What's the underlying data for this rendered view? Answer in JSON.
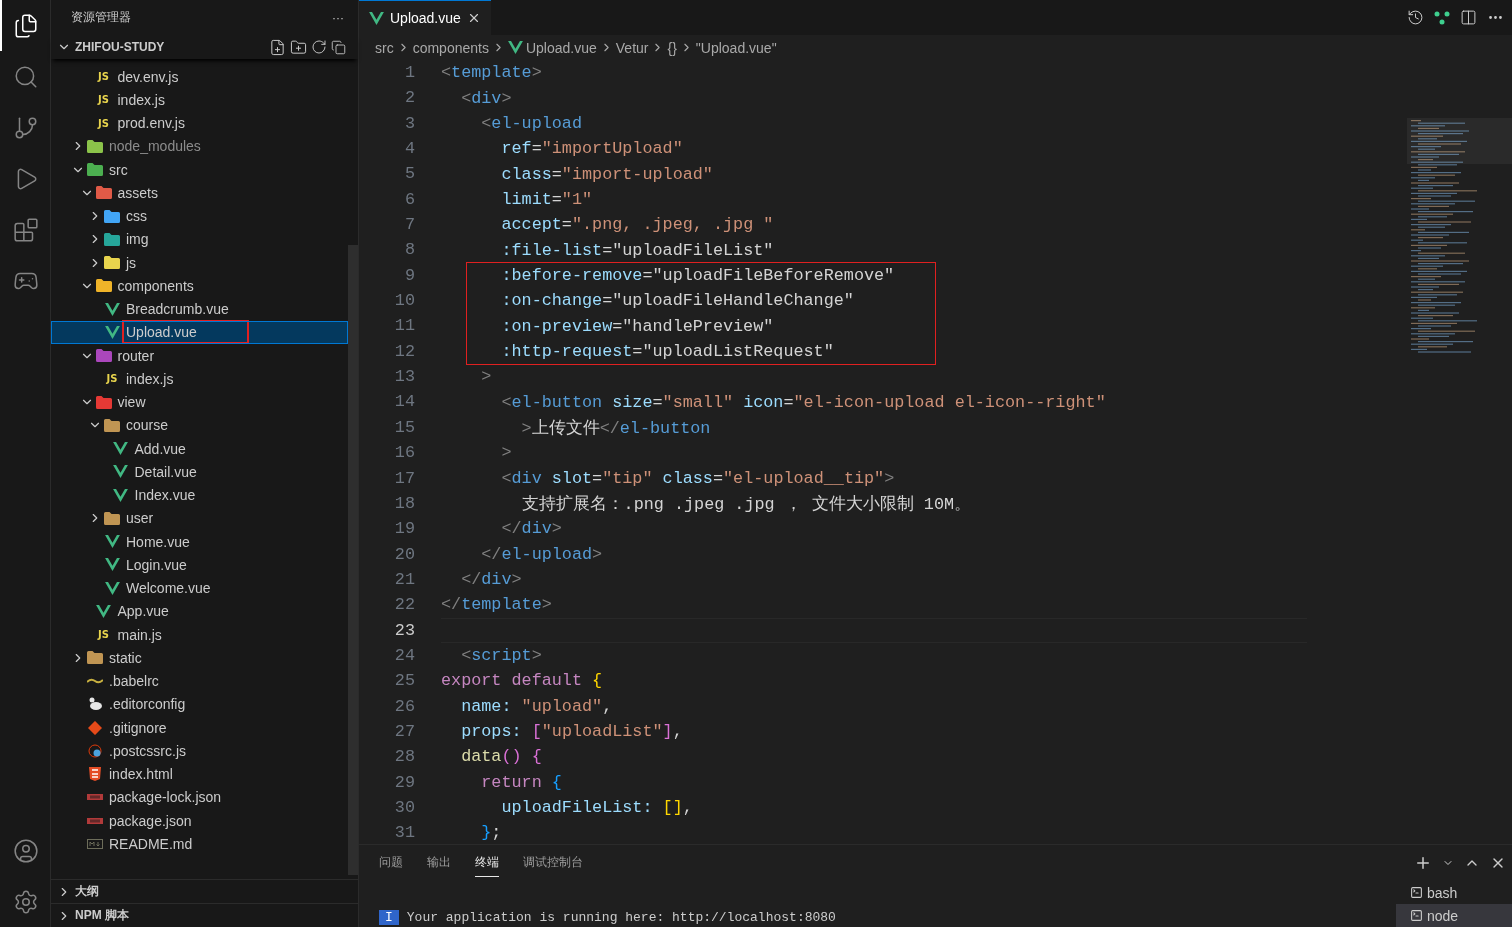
{
  "activity_bar": {
    "items": [
      {
        "kind": "explorer",
        "selected": true
      },
      {
        "kind": "search",
        "selected": false
      },
      {
        "kind": "source-control",
        "selected": false
      },
      {
        "kind": "run",
        "selected": false
      },
      {
        "kind": "extensions",
        "selected": false
      },
      {
        "kind": "remote",
        "selected": false
      }
    ],
    "bottom": [
      {
        "kind": "account"
      },
      {
        "kind": "settings"
      }
    ]
  },
  "sidebar": {
    "title": "资源管理器",
    "more": "···",
    "project": "ZHIFOU-STUDY",
    "tree": [
      {
        "children": [
          {
            "kind": "script",
            "name": "dev.env.js",
            "badge": "JS",
            "selected": false,
            "boxed": false
          },
          {
            "kind": "script",
            "name": "index.js",
            "badge": "JS",
            "selected": false,
            "boxed": false
          },
          {
            "kind": "script",
            "name": "prod.env.js",
            "badge": "JS",
            "selected": false,
            "boxed": false
          }
        ]
      },
      {
        "kind": "folder",
        "name": "node_modules",
        "color": "#8bc34a",
        "expanded": false,
        "dim": true
      },
      {
        "kind": "folder",
        "name": "src",
        "color": "#4caf50",
        "expanded": true,
        "children": [
          {
            "kind": "folder",
            "name": "assets",
            "color": "#e05a47",
            "expanded": true,
            "children": [
              {
                "kind": "folder",
                "name": "css",
                "color": "#42a5f5",
                "expanded": false
              },
              {
                "kind": "folder",
                "name": "img",
                "color": "#26a69a",
                "expanded": false
              },
              {
                "kind": "folder",
                "name": "js",
                "color": "#e8d44d",
                "expanded": false
              }
            ]
          },
          {
            "kind": "folder",
            "name": "components",
            "color": "#f0b429",
            "expanded": true,
            "children": [
              {
                "kind": "vue",
                "name": "Breadcrumb.vue",
                "selected": false,
                "boxed": false
              },
              {
                "kind": "vue",
                "name": "Upload.vue",
                "selected": true,
                "boxed": true
              }
            ]
          },
          {
            "kind": "folder",
            "name": "router",
            "color": "#ab47bc",
            "expanded": true,
            "children": [
              {
                "kind": "script",
                "name": "index.js",
                "badge": "JS",
                "selected": false,
                "boxed": false
              }
            ]
          },
          {
            "kind": "folder",
            "name": "view",
            "color": "#e53935",
            "expanded": true,
            "children": [
              {
                "kind": "folder",
                "name": "course",
                "color": "#c09553",
                "expanded": true,
                "children": [
                  {
                    "kind": "vue",
                    "name": "Add.vue",
                    "selected": false,
                    "boxed": false
                  },
                  {
                    "kind": "vue",
                    "name": "Detail.vue",
                    "selected": false,
                    "boxed": false
                  },
                  {
                    "kind": "vue",
                    "name": "Index.vue",
                    "selected": false,
                    "boxed": false
                  }
                ]
              },
              {
                "kind": "folder",
                "name": "user",
                "color": "#c09553",
                "expanded": false
              },
              {
                "kind": "vue",
                "name": "Home.vue",
                "selected": false,
                "boxed": false
              },
              {
                "kind": "vue",
                "name": "Login.vue",
                "selected": false,
                "boxed": false
              },
              {
                "kind": "vue",
                "name": "Welcome.vue",
                "selected": false,
                "boxed": false
              }
            ]
          },
          {
            "kind": "vue",
            "name": "App.vue",
            "selected": false,
            "boxed": false
          },
          {
            "kind": "script",
            "name": "main.js",
            "badge": "JS",
            "selected": false,
            "boxed": false
          }
        ]
      },
      {
        "kind": "folder",
        "name": "static",
        "color": "#c09553",
        "expanded": false
      },
      {
        "kind": "babel",
        "name": ".babelrc",
        "selected": false,
        "boxed": false
      },
      {
        "kind": "editorconfig",
        "name": ".editorconfig",
        "selected": false,
        "boxed": false
      },
      {
        "kind": "git",
        "name": ".gitignore",
        "selected": false,
        "boxed": false
      },
      {
        "kind": "postcss",
        "name": ".postcssrc.js",
        "selected": false,
        "boxed": false
      },
      {
        "kind": "html",
        "name": "index.html",
        "selected": false,
        "boxed": false
      },
      {
        "kind": "npm",
        "name": "package-lock.json",
        "selected": false,
        "boxed": false
      },
      {
        "kind": "npm",
        "name": "package.json",
        "selected": false,
        "boxed": false
      },
      {
        "kind": "markdown",
        "name": "README.md",
        "selected": false,
        "boxed": false
      }
    ],
    "sections": [
      {
        "title": "大纲",
        "expanded": false
      },
      {
        "title": "NPM 脚本",
        "expanded": false
      }
    ]
  },
  "editor": {
    "tabs": [
      {
        "label": "Upload.vue",
        "selected": true
      }
    ],
    "breadcrumbs": [
      {
        "label": "src"
      },
      {
        "label": "components"
      },
      {
        "label": "Upload.vue",
        "kind": "vue"
      },
      {
        "label": "Vetur"
      },
      {
        "label": "{}"
      },
      {
        "label": "\"Upload.vue\""
      }
    ],
    "lines": [
      {
        "number": "1",
        "current": false,
        "boxed": false,
        "tokens": [
          {
            "kind": "br",
            "text": "<"
          },
          {
            "kind": "tag",
            "text": "template"
          },
          {
            "kind": "br",
            "text": ">"
          }
        ]
      },
      {
        "number": "2",
        "current": false,
        "boxed": false,
        "tokens": [
          {
            "kind": "br",
            "text": "  <"
          },
          {
            "kind": "tag",
            "text": "div"
          },
          {
            "kind": "br",
            "text": ">"
          }
        ]
      },
      {
        "number": "3",
        "current": false,
        "boxed": false,
        "tokens": [
          {
            "kind": "br",
            "text": "    <"
          },
          {
            "kind": "tag",
            "text": "el-upload"
          }
        ]
      },
      {
        "number": "4",
        "current": false,
        "boxed": false,
        "tokens": [
          {
            "kind": "attr",
            "text": "      ref"
          },
          {
            "kind": "plain",
            "text": "="
          },
          {
            "kind": "str",
            "text": "\"importUpload\""
          }
        ]
      },
      {
        "number": "5",
        "current": false,
        "boxed": false,
        "tokens": [
          {
            "kind": "attr",
            "text": "      class"
          },
          {
            "kind": "plain",
            "text": "="
          },
          {
            "kind": "str",
            "text": "\"import-upload\""
          }
        ]
      },
      {
        "number": "6",
        "current": false,
        "boxed": false,
        "tokens": [
          {
            "kind": "attr",
            "text": "      limit"
          },
          {
            "kind": "plain",
            "text": "="
          },
          {
            "kind": "str",
            "text": "\"1\""
          }
        ]
      },
      {
        "number": "7",
        "current": false,
        "boxed": false,
        "tokens": [
          {
            "kind": "attr",
            "text": "      accept"
          },
          {
            "kind": "plain",
            "text": "="
          },
          {
            "kind": "str",
            "text": "\".png, .jpeg, .jpg \""
          }
        ]
      },
      {
        "number": "8",
        "current": false,
        "boxed": false,
        "tokens": [
          {
            "kind": "attr",
            "text": "      :file-list"
          },
          {
            "kind": "plain",
            "text": "=\"uploadFileList\""
          }
        ]
      },
      {
        "number": "9",
        "current": false,
        "boxed": true,
        "tokens": [
          {
            "kind": "attr",
            "text": "      :before-remove"
          },
          {
            "kind": "plain",
            "text": "=\"uploadFileBeforeRemove\""
          }
        ]
      },
      {
        "number": "10",
        "current": false,
        "boxed": true,
        "tokens": [
          {
            "kind": "attr",
            "text": "      :on-change"
          },
          {
            "kind": "plain",
            "text": "=\"uploadFileHandleChange\""
          }
        ]
      },
      {
        "number": "11",
        "current": false,
        "boxed": true,
        "tokens": [
          {
            "kind": "attr",
            "text": "      :on-preview"
          },
          {
            "kind": "plain",
            "text": "=\"handlePreview\""
          }
        ]
      },
      {
        "number": "12",
        "current": false,
        "boxed": true,
        "tokens": [
          {
            "kind": "attr",
            "text": "      :http-request"
          },
          {
            "kind": "plain",
            "text": "=\"uploadListRequest\""
          }
        ]
      },
      {
        "number": "13",
        "current": false,
        "boxed": false,
        "tokens": [
          {
            "kind": "br",
            "text": "    >"
          }
        ]
      },
      {
        "number": "14",
        "current": false,
        "boxed": false,
        "tokens": [
          {
            "kind": "br",
            "text": "      <"
          },
          {
            "kind": "tag",
            "text": "el-button"
          },
          {
            "kind": "attr",
            "text": " size"
          },
          {
            "kind": "plain",
            "text": "="
          },
          {
            "kind": "str",
            "text": "\"small\""
          },
          {
            "kind": "attr",
            "text": " icon"
          },
          {
            "kind": "plain",
            "text": "="
          },
          {
            "kind": "str",
            "text": "\"el-icon-upload el-icon--right\""
          }
        ]
      },
      {
        "number": "15",
        "current": false,
        "boxed": false,
        "tokens": [
          {
            "kind": "br",
            "text": "        >"
          },
          {
            "kind": "plain",
            "text": "上传文件"
          },
          {
            "kind": "br",
            "text": "</"
          },
          {
            "kind": "tag",
            "text": "el-button"
          }
        ]
      },
      {
        "number": "16",
        "current": false,
        "boxed": false,
        "tokens": [
          {
            "kind": "br",
            "text": "      >"
          }
        ]
      },
      {
        "number": "17",
        "current": false,
        "boxed": false,
        "tokens": [
          {
            "kind": "br",
            "text": "      <"
          },
          {
            "kind": "tag",
            "text": "div"
          },
          {
            "kind": "attr",
            "text": " slot"
          },
          {
            "kind": "plain",
            "text": "="
          },
          {
            "kind": "str",
            "text": "\"tip\""
          },
          {
            "kind": "attr",
            "text": " class"
          },
          {
            "kind": "plain",
            "text": "="
          },
          {
            "kind": "str",
            "text": "\"el-upload__tip\""
          },
          {
            "kind": "br",
            "text": ">"
          }
        ]
      },
      {
        "number": "18",
        "current": false,
        "boxed": false,
        "tokens": [
          {
            "kind": "plain",
            "text": "        支持扩展名：.png .jpeg .jpg ， 文件大小限制 10M。"
          }
        ]
      },
      {
        "number": "19",
        "current": false,
        "boxed": false,
        "tokens": [
          {
            "kind": "br",
            "text": "      </"
          },
          {
            "kind": "tag",
            "text": "div"
          },
          {
            "kind": "br",
            "text": ">"
          }
        ]
      },
      {
        "number": "20",
        "current": false,
        "boxed": false,
        "tokens": [
          {
            "kind": "br",
            "text": "    </"
          },
          {
            "kind": "tag",
            "text": "el-upload"
          },
          {
            "kind": "br",
            "text": ">"
          }
        ]
      },
      {
        "number": "21",
        "current": false,
        "boxed": false,
        "tokens": [
          {
            "kind": "br",
            "text": "  </"
          },
          {
            "kind": "tag",
            "text": "div"
          },
          {
            "kind": "br",
            "text": ">"
          }
        ]
      },
      {
        "number": "22",
        "current": false,
        "boxed": false,
        "tokens": [
          {
            "kind": "br",
            "text": "</"
          },
          {
            "kind": "tag",
            "text": "template"
          },
          {
            "kind": "br",
            "text": ">"
          }
        ]
      },
      {
        "number": "23",
        "current": true,
        "boxed": false
      },
      {
        "number": "24",
        "current": false,
        "boxed": false,
        "tokens": [
          {
            "kind": "br",
            "text": "  <"
          },
          {
            "kind": "tag",
            "text": "script"
          },
          {
            "kind": "br",
            "text": ">"
          }
        ]
      },
      {
        "number": "25",
        "current": false,
        "boxed": false,
        "tokens": [
          {
            "kind": "kw",
            "text": "export default"
          },
          {
            "kind": "b1",
            "text": " {"
          }
        ]
      },
      {
        "number": "26",
        "current": false,
        "boxed": false,
        "tokens": [
          {
            "kind": "attr",
            "text": "  name:"
          },
          {
            "kind": "str",
            "text": " \"upload\""
          },
          {
            "kind": "plain",
            "text": ","
          }
        ]
      },
      {
        "number": "27",
        "current": false,
        "boxed": false,
        "tokens": [
          {
            "kind": "attr",
            "text": "  props:"
          },
          {
            "kind": "b2",
            "text": " ["
          },
          {
            "kind": "str",
            "text": "\"uploadList\""
          },
          {
            "kind": "b2",
            "text": "]"
          },
          {
            "kind": "plain",
            "text": ","
          }
        ]
      },
      {
        "number": "28",
        "current": false,
        "boxed": false,
        "tokens": [
          {
            "kind": "fn",
            "text": "  data"
          },
          {
            "kind": "b2",
            "text": "() {"
          }
        ]
      },
      {
        "number": "29",
        "current": false,
        "boxed": false,
        "tokens": [
          {
            "kind": "kw",
            "text": "    return"
          },
          {
            "kind": "b3",
            "text": " {"
          }
        ]
      },
      {
        "number": "30",
        "current": false,
        "boxed": false,
        "tokens": [
          {
            "kind": "attr",
            "text": "      uploadFileList:"
          },
          {
            "kind": "b1",
            "text": " []"
          },
          {
            "kind": "plain",
            "text": ","
          }
        ]
      },
      {
        "number": "31",
        "current": false,
        "boxed": false,
        "tokens": [
          {
            "kind": "b3",
            "text": "    }"
          },
          {
            "kind": "plain",
            "text": ";"
          }
        ]
      }
    ]
  },
  "panel": {
    "tabs": [
      {
        "label": "问题",
        "selected": false
      },
      {
        "label": "输出",
        "selected": false
      },
      {
        "label": "终端",
        "selected": true
      },
      {
        "label": "调试控制台",
        "selected": false
      }
    ],
    "terminal_line": {
      "badge": "I",
      "text": "Your application is running here: http://localhost:8080"
    },
    "terminals": [
      {
        "label": "bash",
        "selected": false
      },
      {
        "label": "node",
        "selected": true
      }
    ]
  }
}
